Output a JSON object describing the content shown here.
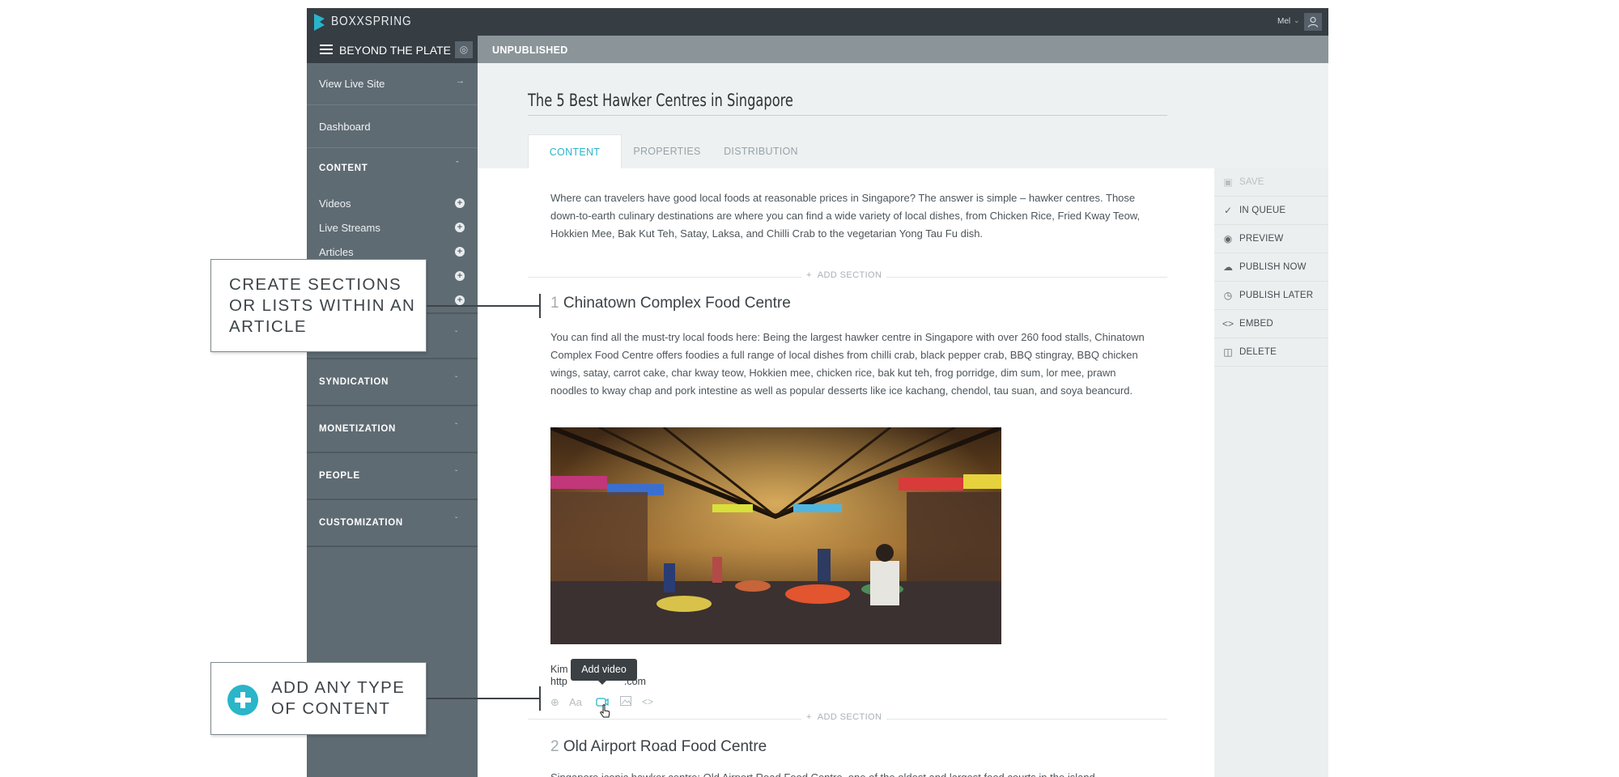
{
  "topbar": {
    "brand": "BOXXSPRING",
    "user": "Mel"
  },
  "sidebar": {
    "site_name": "BEYOND THE PLATE",
    "view_live_site": "View Live Site",
    "dashboard": "Dashboard",
    "content_section": "CONTENT",
    "content_items": [
      "Videos",
      "Live Streams",
      "Articles"
    ],
    "sections": [
      "SYNDICATION",
      "MONETIZATION",
      "PEOPLE",
      "CUSTOMIZATION"
    ]
  },
  "main": {
    "status": "UNPUBLISHED",
    "title": "The 5 Best Hawker Centres in Singapore",
    "tabs": [
      "CONTENT",
      "PROPERTIES",
      "DISTRIBUTION"
    ],
    "active_tab": "CONTENT",
    "intro": "Where can travelers have good local foods at reasonable prices in Singapore? The answer is simple – hawker centres. Those down-to-earth culinary destinations are where you can find a wide variety of local dishes, from Chicken Rice, Fried Kway Teow, Hokkien Mee, Bak Kut Teh, Satay, Laksa, and Chilli Crab to the vegetarian Yong Tau Fu dish.",
    "add_section_label": "ADD SECTION",
    "sections": [
      {
        "number": "1",
        "heading": "Chinatown Complex Food Centre",
        "body": "You can find all the must-try local foods here: Being the largest hawker centre in Singapore with over 260 food stalls, Chinatown Complex Food Centre offers foodies a full range of local dishes from chilli crab, black pepper crab, BBQ stingray, BBQ chicken wings, satay, carrot cake, char kway teow, Hokkien mee, chicken rice, bak kut teh, frog porridge, dim sum, lor mee, prawn noodles to kway chap and pork intestine as well as popular desserts like ice kachang, chendol, tau suan, and soya beancurd.",
        "caption_line1": "Kim",
        "caption_line2": "http",
        "caption_line2_end": ".com"
      },
      {
        "number": "2",
        "heading": "Old Airport Road Food Centre",
        "body": "Singapore iconic hawker centre: Old Airport Road Food Centre, one of the oldest and largest food courts in the island"
      }
    ],
    "toolbar_icons": [
      "add-icon",
      "text-icon",
      "video-icon",
      "image-icon",
      "embed-icon"
    ],
    "tooltip": "Add video"
  },
  "actions": [
    {
      "icon": "save-icon",
      "label": "SAVE",
      "enabled": false
    },
    {
      "icon": "check-icon",
      "label": "IN QUEUE",
      "enabled": true
    },
    {
      "icon": "eye-icon",
      "label": "PREVIEW",
      "enabled": true
    },
    {
      "icon": "cloud-upload-icon",
      "label": "PUBLISH NOW",
      "enabled": true
    },
    {
      "icon": "clock-icon",
      "label": "PUBLISH LATER",
      "enabled": true
    },
    {
      "icon": "code-icon",
      "label": "EMBED",
      "enabled": true
    },
    {
      "icon": "trash-icon",
      "label": "DELETE",
      "enabled": true
    }
  ],
  "callouts": [
    {
      "text": "CREATE SECTIONS OR LISTS WITHIN AN ARTICLE"
    },
    {
      "text": "ADD ANY TYPE OF CONTENT"
    }
  ],
  "colors": {
    "accent": "#2ab5c9",
    "sidebar": "#5f6b73",
    "topbar": "#363d43",
    "status_bar": "#8b9599"
  }
}
